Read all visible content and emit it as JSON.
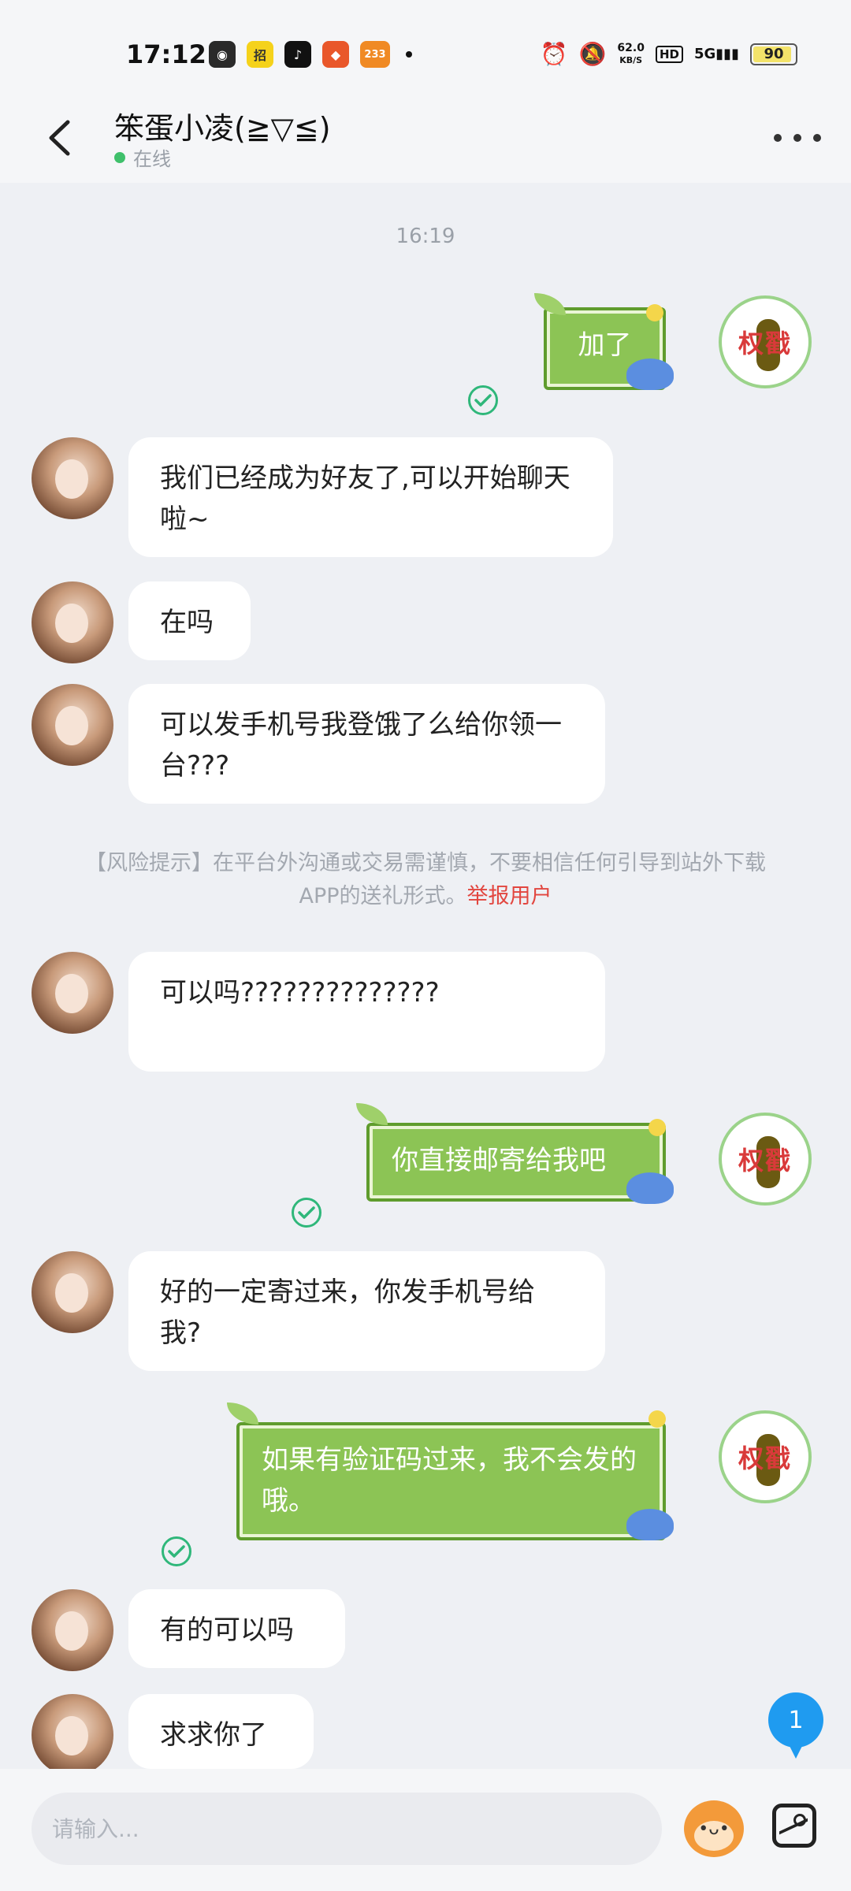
{
  "status_bar": {
    "time": "17:12",
    "apps": [
      {
        "name": "wechat-app-icon",
        "glyph": "◉",
        "color": "#2a2a2a"
      },
      {
        "name": "zhaopin-app-icon",
        "glyph": "招",
        "color": "#f5d21b"
      },
      {
        "name": "tiktok-app-icon",
        "glyph": "♪",
        "color": "#111111"
      },
      {
        "name": "game-app-icon",
        "glyph": "◆",
        "color": "#e9572a"
      },
      {
        "name": "233-app-icon",
        "glyph": "233",
        "color": "#f08a24"
      }
    ],
    "net_speed_value": "62.0",
    "net_speed_unit": "KB/S",
    "hd": "HD",
    "signal": "5G",
    "battery": "90"
  },
  "header": {
    "title": "笨蛋小凌(≧▽≦)",
    "status": "在线"
  },
  "chat": {
    "timestamp": "16:19",
    "messages": [
      {
        "side": "right",
        "text": "加了"
      },
      {
        "side": "left",
        "text": "我们已经成为好友了,可以开始聊天啦~"
      },
      {
        "side": "left",
        "text": "在吗"
      },
      {
        "side": "left",
        "text": "可以发手机号我登饿了么给你领一台???"
      },
      {
        "side": "left",
        "text": "可以吗??????????????"
      },
      {
        "side": "right",
        "text": "你直接邮寄给我吧"
      },
      {
        "side": "left",
        "text": "好的一定寄过来，你发手机号给我?"
      },
      {
        "side": "right",
        "text": "如果有验证码过来，我不会发的哦。"
      },
      {
        "side": "left",
        "text": "有的可以吗"
      },
      {
        "side": "left",
        "text": "求求你了"
      }
    ],
    "risk_notice": "【风险提示】在平台外沟通或交易需谨慎，不要相信任何引导到站外下载APP的送礼形式。",
    "report_link": "举报用户",
    "avatar_seal_text": "权戳",
    "unread_count": "1"
  },
  "input_bar": {
    "placeholder": "请输入..."
  },
  "colors": {
    "sent_bubble": "#8cc455",
    "received_bubble": "#ffffff",
    "read_check": "#2fb77a",
    "online_dot": "#3fc06b",
    "report_link": "#e2463f",
    "fab": "#1f9bf0"
  }
}
